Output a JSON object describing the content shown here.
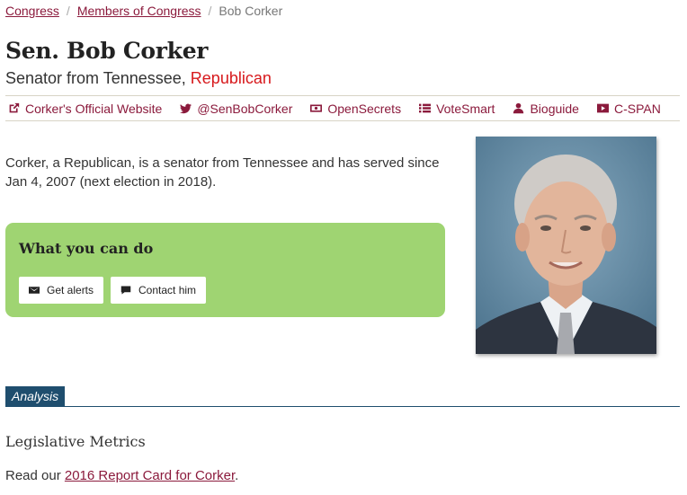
{
  "breadcrumb": {
    "items": [
      "Congress",
      "Members of Congress"
    ],
    "separator": "/",
    "current": "Bob Corker"
  },
  "header": {
    "title": "Sen. Bob Corker",
    "subtitle_prefix": "Senator from Tennessee, ",
    "party": "Republican"
  },
  "links": [
    {
      "label": "Corker's Official Website",
      "icon": "external-link-icon"
    },
    {
      "label": "@SenBobCorker",
      "icon": "twitter-icon"
    },
    {
      "label": "OpenSecrets",
      "icon": "money-icon"
    },
    {
      "label": "VoteSmart",
      "icon": "list-icon"
    },
    {
      "label": "Bioguide",
      "icon": "user-icon"
    },
    {
      "label": "C-SPAN",
      "icon": "video-icon"
    }
  ],
  "intro": "Corker, a Republican, is a senator from Tennessee and has served since Jan 4, 2007 (next election in 2018).",
  "actions": {
    "title": "What you can do",
    "alerts_label": "Get alerts",
    "contact_label": "Contact him"
  },
  "analysis": {
    "tab_label": "Analysis",
    "heading": "Legislative Metrics",
    "report_prefix": "Read our ",
    "report_link": "2016 Report Card for Corker",
    "report_suffix": "."
  },
  "colors": {
    "link": "#8b1a3c",
    "party": "#d7191c",
    "action_box": "#9fd472",
    "analysis_tab": "#1f4e6e"
  }
}
